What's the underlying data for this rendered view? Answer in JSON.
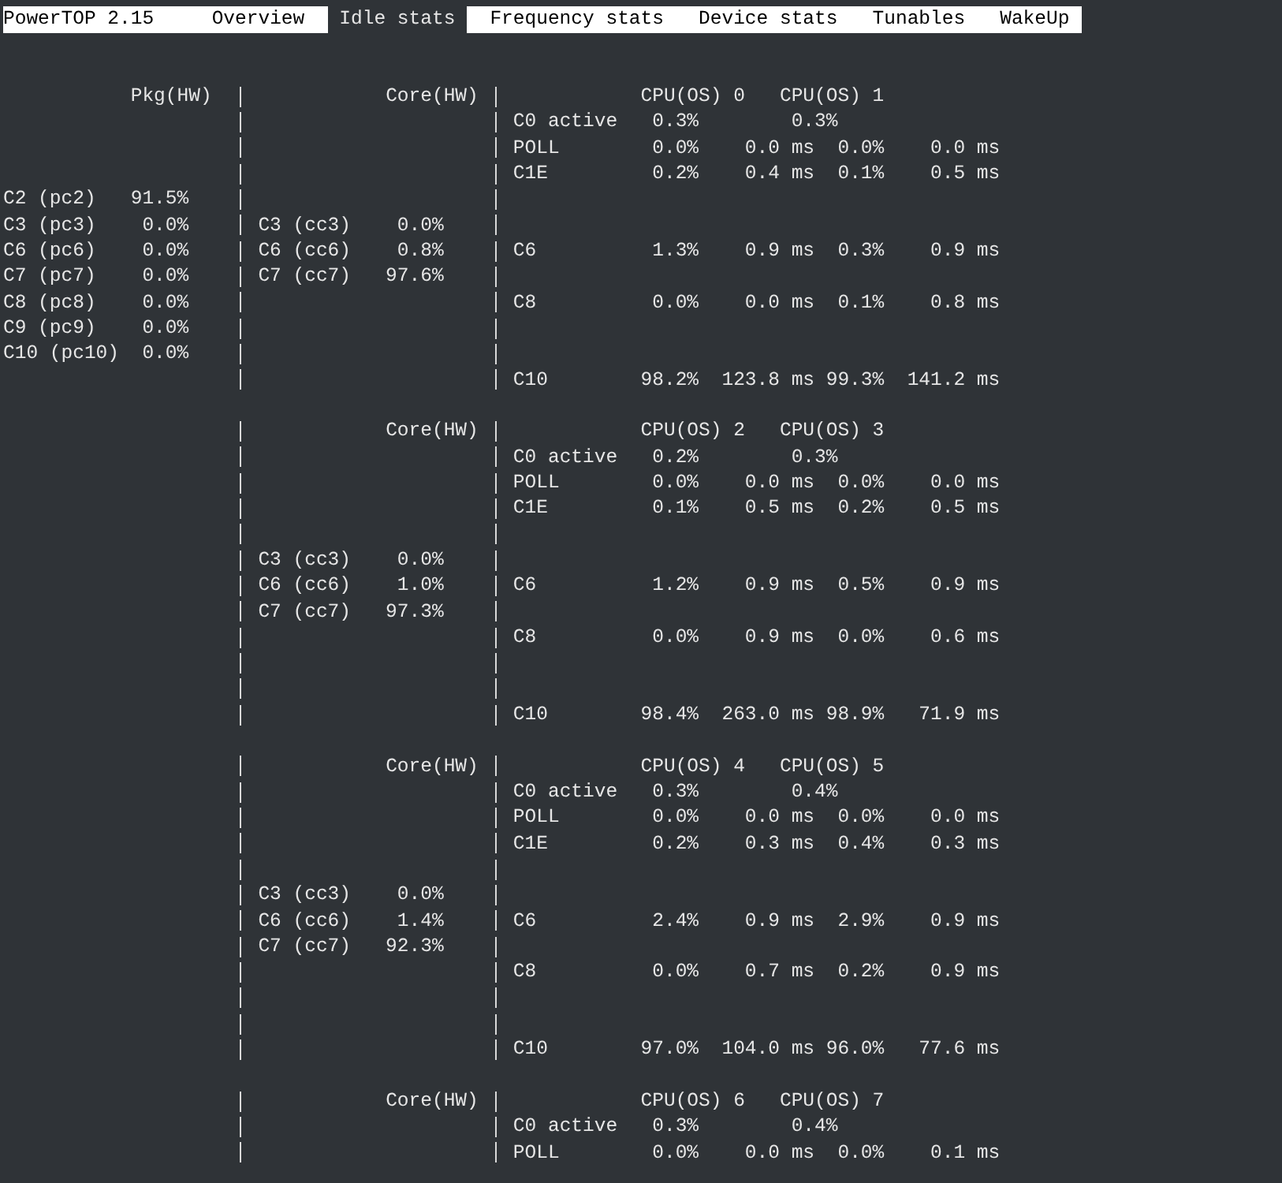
{
  "title": "PowerTOP 2.15",
  "tabs": [
    {
      "label": "Overview",
      "selected": false
    },
    {
      "label": "Idle stats",
      "selected": true
    },
    {
      "label": "Frequency stats",
      "selected": false
    },
    {
      "label": "Device stats",
      "selected": false
    },
    {
      "label": "Tunables",
      "selected": false
    },
    {
      "label": "WakeUp",
      "selected": false
    }
  ],
  "package": {
    "heading": "Pkg(HW)",
    "states": [
      {
        "name": "C2 (pc2)",
        "value": "91.5%"
      },
      {
        "name": "C3 (pc3)",
        "value": "0.0%"
      },
      {
        "name": "C6 (pc6)",
        "value": "0.0%"
      },
      {
        "name": "C7 (pc7)",
        "value": "0.0%"
      },
      {
        "name": "C8 (pc8)",
        "value": "0.0%"
      },
      {
        "name": "C9 (pc9)",
        "value": "0.0%"
      },
      {
        "name": "C10 (pc10)",
        "value": "0.0%"
      }
    ]
  },
  "cores": [
    {
      "heading": "Core(HW)",
      "states": [
        {
          "name": "C3 (cc3)",
          "value": "0.0%"
        },
        {
          "name": "C6 (cc6)",
          "value": "0.8%"
        },
        {
          "name": "C7 (cc7)",
          "value": "97.6%"
        }
      ],
      "cpus": [
        "CPU(OS) 0",
        "CPU(OS) 1"
      ],
      "cpu_states": [
        {
          "kind": "active",
          "name": "C0 active",
          "values": [
            "0.3%",
            "0.3%"
          ]
        },
        {
          "kind": "idle",
          "name": "POLL",
          "values": [
            "0.0%",
            "0.0 ms",
            "0.0%",
            "0.0 ms"
          ]
        },
        {
          "kind": "idle",
          "name": "C1E",
          "values": [
            "0.2%",
            "0.4 ms",
            "0.1%",
            "0.5 ms"
          ]
        },
        {
          "kind": "idle",
          "name": "C6",
          "values": [
            "1.3%",
            "0.9 ms",
            "0.3%",
            "0.9 ms"
          ]
        },
        {
          "kind": "idle",
          "name": "C8",
          "values": [
            "0.0%",
            "0.0 ms",
            "0.1%",
            "0.8 ms"
          ]
        },
        {
          "kind": "idle",
          "name": "C10",
          "values": [
            "98.2%",
            "123.8 ms",
            "99.3%",
            "141.2 ms"
          ]
        }
      ]
    },
    {
      "heading": "Core(HW)",
      "states": [
        {
          "name": "C3 (cc3)",
          "value": "0.0%"
        },
        {
          "name": "C6 (cc6)",
          "value": "1.0%"
        },
        {
          "name": "C7 (cc7)",
          "value": "97.3%"
        }
      ],
      "cpus": [
        "CPU(OS) 2",
        "CPU(OS) 3"
      ],
      "cpu_states": [
        {
          "kind": "active",
          "name": "C0 active",
          "values": [
            "0.2%",
            "0.3%"
          ]
        },
        {
          "kind": "idle",
          "name": "POLL",
          "values": [
            "0.0%",
            "0.0 ms",
            "0.0%",
            "0.0 ms"
          ]
        },
        {
          "kind": "idle",
          "name": "C1E",
          "values": [
            "0.1%",
            "0.5 ms",
            "0.2%",
            "0.5 ms"
          ]
        },
        {
          "kind": "idle",
          "name": "C6",
          "values": [
            "1.2%",
            "0.9 ms",
            "0.5%",
            "0.9 ms"
          ]
        },
        {
          "kind": "idle",
          "name": "C8",
          "values": [
            "0.0%",
            "0.9 ms",
            "0.0%",
            "0.6 ms"
          ]
        },
        {
          "kind": "idle",
          "name": "C10",
          "values": [
            "98.4%",
            "263.0 ms",
            "98.9%",
            "71.9 ms"
          ]
        }
      ]
    },
    {
      "heading": "Core(HW)",
      "states": [
        {
          "name": "C3 (cc3)",
          "value": "0.0%"
        },
        {
          "name": "C6 (cc6)",
          "value": "1.4%"
        },
        {
          "name": "C7 (cc7)",
          "value": "92.3%"
        }
      ],
      "cpus": [
        "CPU(OS) 4",
        "CPU(OS) 5"
      ],
      "cpu_states": [
        {
          "kind": "active",
          "name": "C0 active",
          "values": [
            "0.3%",
            "0.4%"
          ]
        },
        {
          "kind": "idle",
          "name": "POLL",
          "values": [
            "0.0%",
            "0.0 ms",
            "0.0%",
            "0.0 ms"
          ]
        },
        {
          "kind": "idle",
          "name": "C1E",
          "values": [
            "0.2%",
            "0.3 ms",
            "0.4%",
            "0.3 ms"
          ]
        },
        {
          "kind": "idle",
          "name": "C6",
          "values": [
            "2.4%",
            "0.9 ms",
            "2.9%",
            "0.9 ms"
          ]
        },
        {
          "kind": "idle",
          "name": "C8",
          "values": [
            "0.0%",
            "0.7 ms",
            "0.2%",
            "0.9 ms"
          ]
        },
        {
          "kind": "idle",
          "name": "C10",
          "values": [
            "97.0%",
            "104.0 ms",
            "96.0%",
            "77.6 ms"
          ]
        }
      ]
    },
    {
      "heading": "Core(HW)",
      "cpus": [
        "CPU(OS) 6",
        "CPU(OS) 7"
      ],
      "cpu_states": [
        {
          "kind": "active",
          "name": "C0 active",
          "values": [
            "0.3%",
            "0.4%"
          ]
        },
        {
          "kind": "idle",
          "name": "POLL",
          "values": [
            "0.0%",
            "0.0 ms",
            "0.0%",
            "0.1 ms"
          ]
        }
      ]
    }
  ]
}
